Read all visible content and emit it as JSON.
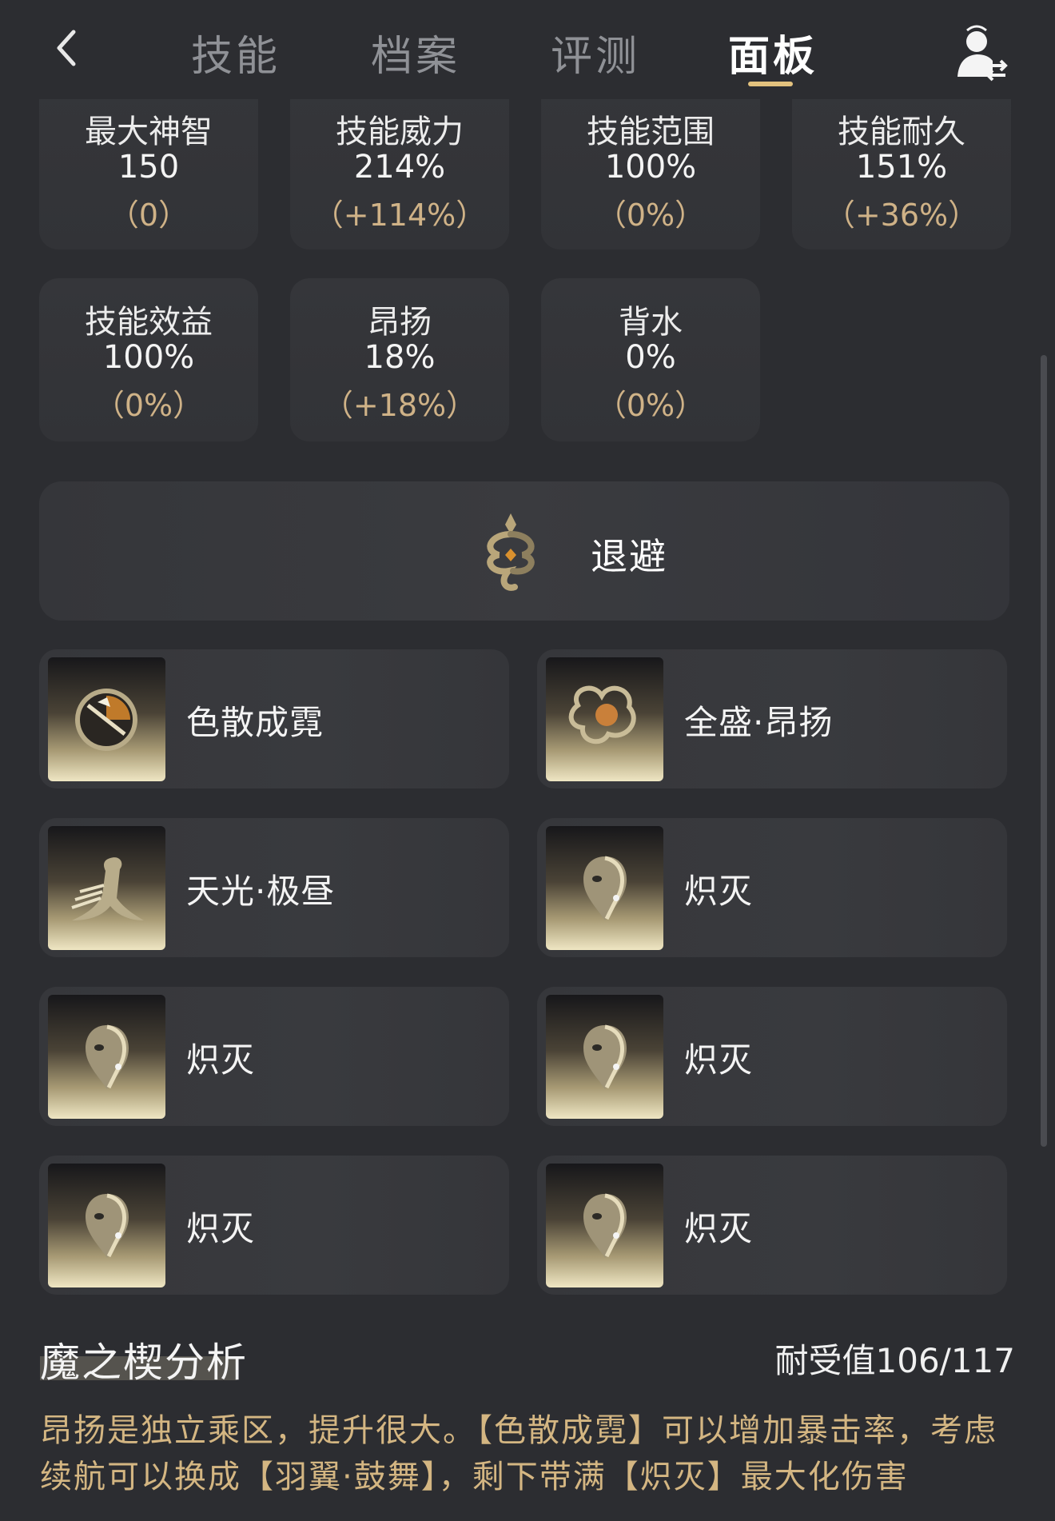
{
  "header": {
    "tabs": [
      {
        "label": "技能"
      },
      {
        "label": "档案"
      },
      {
        "label": "评测"
      },
      {
        "label": "面板"
      }
    ],
    "active_tab": "面板"
  },
  "stats": [
    {
      "name": "最大神智",
      "value": "150",
      "delta": "（0）"
    },
    {
      "name": "技能威力",
      "value": "214%",
      "delta": "（+114%）"
    },
    {
      "name": "技能范围",
      "value": "100%",
      "delta": "（0%）"
    },
    {
      "name": "技能耐久",
      "value": "151%",
      "delta": "（+36%）"
    },
    {
      "name": "技能效益",
      "value": "100%",
      "delta": "（0%）"
    },
    {
      "name": "昂扬",
      "value": "18%",
      "delta": "（+18%）"
    },
    {
      "name": "背水",
      "value": "0%",
      "delta": "（0%）"
    }
  ],
  "banner": {
    "label": "退避",
    "icon": "serpent-emblem-icon"
  },
  "items": [
    {
      "label": "色散成霓",
      "icon": "winged-disc-icon"
    },
    {
      "label": "全盛·昂扬",
      "icon": "serpent-orb-icon"
    },
    {
      "label": "天光·极昼",
      "icon": "bird-icon"
    },
    {
      "label": "炽灭",
      "icon": "mask-icon"
    },
    {
      "label": "炽灭",
      "icon": "mask-icon"
    },
    {
      "label": "炽灭",
      "icon": "mask-icon"
    },
    {
      "label": "炽灭",
      "icon": "mask-icon"
    },
    {
      "label": "炽灭",
      "icon": "mask-icon"
    }
  ],
  "analysis": {
    "title": "魔之楔分析",
    "durability": "耐受值106/117",
    "text": "昂扬是独立乘区，提升很大。【色散成霓】可以增加暴击率，考虑续航可以换成【羽翼·鼓舞】，剩下带满【炽灭】最大化伤害"
  },
  "colors": {
    "background": "#2c2d31",
    "accent_gold": "#e3c27e",
    "delta_text": "#cfb287",
    "analysis_text": "#d4b682"
  }
}
